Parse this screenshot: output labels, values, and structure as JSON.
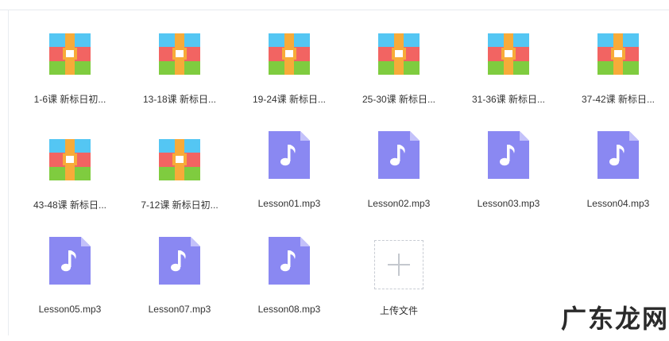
{
  "colors": {
    "archive_blue": "#54c6f3",
    "archive_red": "#f26462",
    "archive_green": "#7fcc3f",
    "archive_strap": "#f7ab39",
    "audio_purple": "#8a88f2",
    "audio_fold": "#c3c1fa"
  },
  "files": [
    {
      "name": "1-6课 新标日初...",
      "type": "archive",
      "icon": "archive-icon"
    },
    {
      "name": "13-18课 新标日...",
      "type": "archive",
      "icon": "archive-icon"
    },
    {
      "name": "19-24课 新标日...",
      "type": "archive",
      "icon": "archive-icon"
    },
    {
      "name": "25-30课 新标日...",
      "type": "archive",
      "icon": "archive-icon"
    },
    {
      "name": "31-36课 新标日...",
      "type": "archive",
      "icon": "archive-icon"
    },
    {
      "name": "37-42课 新标日...",
      "type": "archive",
      "icon": "archive-icon"
    },
    {
      "name": "43-48课 新标日...",
      "type": "archive",
      "icon": "archive-icon"
    },
    {
      "name": "7-12课 新标日初...",
      "type": "archive",
      "icon": "archive-icon"
    },
    {
      "name": "Lesson01.mp3",
      "type": "audio",
      "icon": "music-note-icon"
    },
    {
      "name": "Lesson02.mp3",
      "type": "audio",
      "icon": "music-note-icon"
    },
    {
      "name": "Lesson03.mp3",
      "type": "audio",
      "icon": "music-note-icon"
    },
    {
      "name": "Lesson04.mp3",
      "type": "audio",
      "icon": "music-note-icon"
    },
    {
      "name": "Lesson05.mp3",
      "type": "audio",
      "icon": "music-note-icon"
    },
    {
      "name": "Lesson07.mp3",
      "type": "audio",
      "icon": "music-note-icon"
    },
    {
      "name": "Lesson08.mp3",
      "type": "audio",
      "icon": "music-note-icon"
    }
  ],
  "upload": {
    "label": "上传文件",
    "icon": "plus-icon"
  },
  "watermark": "广东龙网"
}
